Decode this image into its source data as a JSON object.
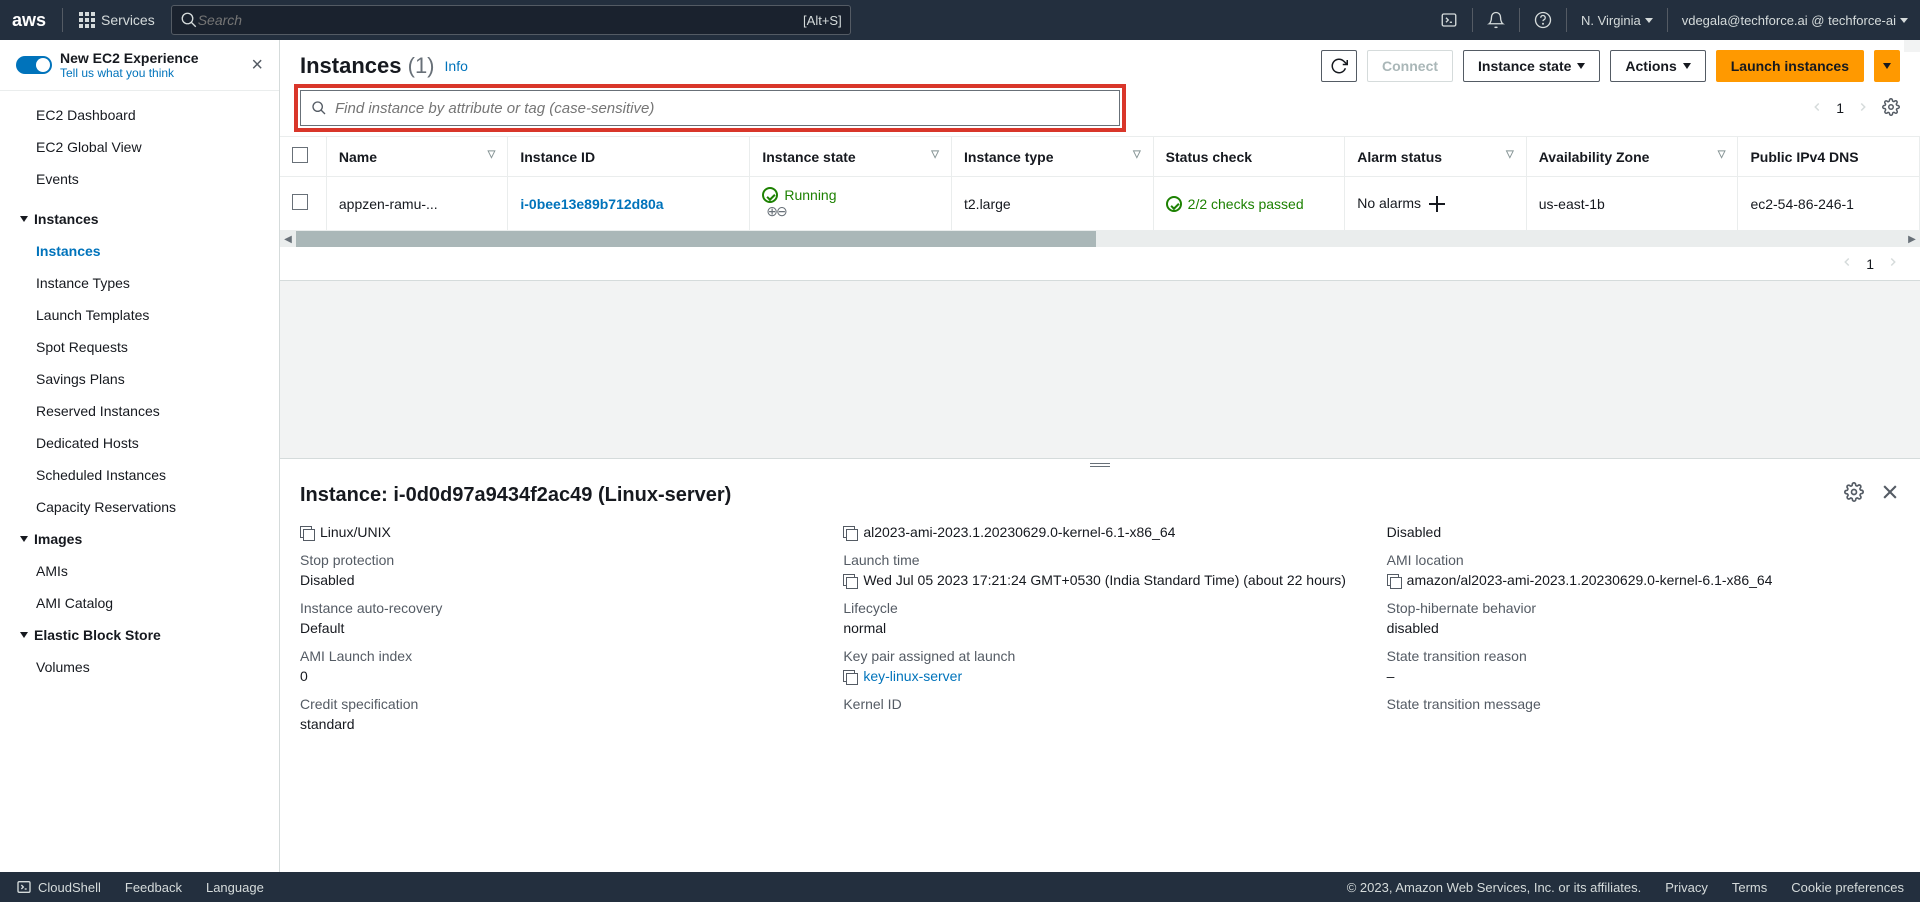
{
  "topnav": {
    "services_label": "Services",
    "search_placeholder": "Search",
    "search_shortcut": "[Alt+S]",
    "region": "N. Virginia",
    "account": "vdegala@techforce.ai @ techforce-ai"
  },
  "experience": {
    "title": "New EC2 Experience",
    "subtitle": "Tell us what you think"
  },
  "sidebar": {
    "top_items": [
      "EC2 Dashboard",
      "EC2 Global View",
      "Events"
    ],
    "groups": [
      {
        "label": "Instances",
        "items": [
          "Instances",
          "Instance Types",
          "Launch Templates",
          "Spot Requests",
          "Savings Plans",
          "Reserved Instances",
          "Dedicated Hosts",
          "Scheduled Instances",
          "Capacity Reservations"
        ],
        "selected": "Instances"
      },
      {
        "label": "Images",
        "items": [
          "AMIs",
          "AMI Catalog"
        ]
      },
      {
        "label": "Elastic Block Store",
        "items": [
          "Volumes"
        ]
      }
    ]
  },
  "header": {
    "title": "Instances",
    "count": "(1)",
    "info": "Info",
    "connect": "Connect",
    "instance_state": "Instance state",
    "actions": "Actions",
    "launch": "Launch instances"
  },
  "search": {
    "placeholder": "Find instance by attribute or tag (case-sensitive)"
  },
  "pager": {
    "current": "1"
  },
  "table": {
    "columns": [
      "Name",
      "Instance ID",
      "Instance state",
      "Instance type",
      "Status check",
      "Alarm status",
      "Availability Zone",
      "Public IPv4 DNS"
    ],
    "rows": [
      {
        "name": "appzen-ramu-...",
        "id": "i-0bee13e89b712d80a",
        "state": "Running",
        "type": "t2.large",
        "status": "2/2 checks passed",
        "alarms": "No alarms",
        "az": "us-east-1b",
        "dns": "ec2-54-86-246-1"
      }
    ]
  },
  "bottom_pager": {
    "current": "1"
  },
  "detail": {
    "title": "Instance: i-0d0d97a9434f2ac49 (Linux-server)",
    "rows": [
      {
        "label": "",
        "copy": true,
        "value": "Linux/UNIX"
      },
      {
        "label": "",
        "copy": true,
        "value": "al2023-ami-2023.1.20230629.0-kernel-6.1-x86_64"
      },
      {
        "label": "",
        "copy": false,
        "value": "Disabled"
      },
      {
        "label": "Stop protection",
        "copy": false,
        "value": "Disabled"
      },
      {
        "label": "Launch time",
        "copy": true,
        "value": "Wed Jul 05 2023 17:21:24 GMT+0530 (India Standard Time) (about 22 hours)"
      },
      {
        "label": "AMI location",
        "copy": true,
        "value": "amazon/al2023-ami-2023.1.20230629.0-kernel-6.1-x86_64"
      },
      {
        "label": "Instance auto-recovery",
        "copy": false,
        "value": "Default"
      },
      {
        "label": "Lifecycle",
        "copy": false,
        "value": "normal"
      },
      {
        "label": "Stop-hibernate behavior",
        "copy": false,
        "value": "disabled"
      },
      {
        "label": "AMI Launch index",
        "copy": false,
        "value": "0"
      },
      {
        "label": "Key pair assigned at launch",
        "copy": true,
        "value": "key-linux-server",
        "link": true
      },
      {
        "label": "State transition reason",
        "copy": false,
        "value": "–"
      },
      {
        "label": "Credit specification",
        "copy": false,
        "value": "standard"
      },
      {
        "label": "Kernel ID",
        "copy": false,
        "value": ""
      },
      {
        "label": "State transition message",
        "copy": false,
        "value": ""
      }
    ]
  },
  "footer": {
    "cloudshell": "CloudShell",
    "feedback": "Feedback",
    "language": "Language",
    "copyright": "© 2023, Amazon Web Services, Inc. or its affiliates.",
    "privacy": "Privacy",
    "terms": "Terms",
    "cookies": "Cookie preferences"
  }
}
